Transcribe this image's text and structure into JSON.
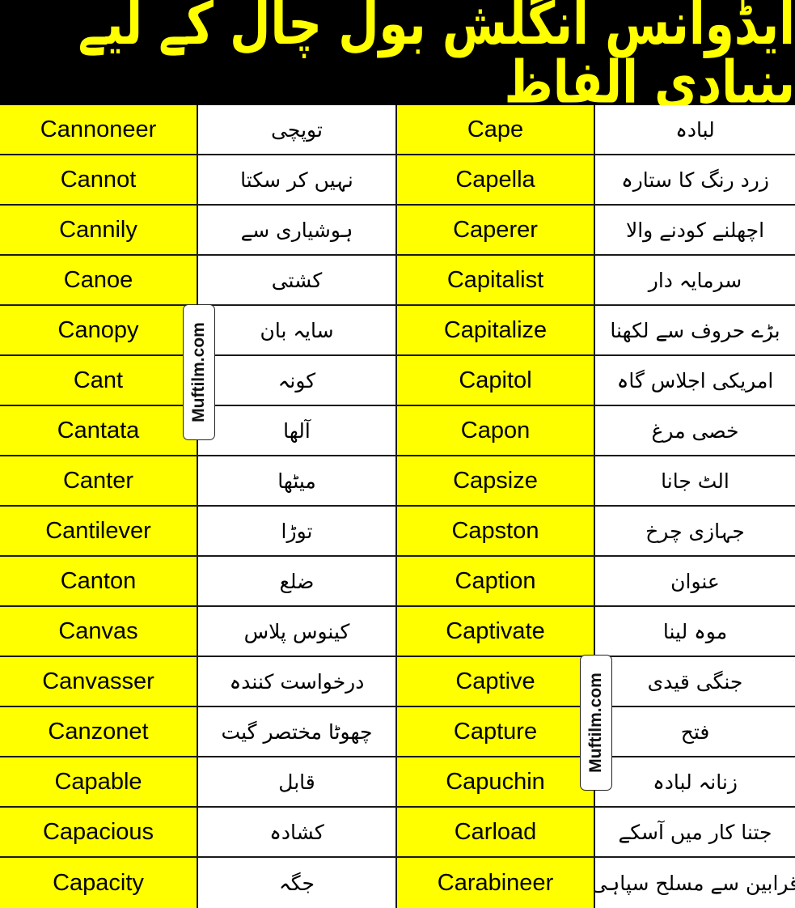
{
  "header": {
    "title": "ایڈوانس انگلش بول چال کے لیے بنیادی الفاظ"
  },
  "colors": {
    "header_bg": "#000000",
    "title_color": "#ffff00",
    "english_cell_bg": "#ffff00",
    "urdu_cell_bg": "#ffffff",
    "grid_line": "#1a1a1a"
  },
  "watermark": {
    "text": "Muftilm.com"
  },
  "rows": [
    {
      "left_en": "Cannoneer",
      "left_ur": "توپچی",
      "right_en": "Cape",
      "right_ur": "لبادہ"
    },
    {
      "left_en": "Cannot",
      "left_ur": "نہیں کر سکتا",
      "right_en": "Capella",
      "right_ur": "زرد رنگ کا ستارہ"
    },
    {
      "left_en": "Cannily",
      "left_ur": "ہوشیاری سے",
      "right_en": "Caperer",
      "right_ur": "اچھلنے کودنے والا"
    },
    {
      "left_en": "Canoe",
      "left_ur": "کشتی",
      "right_en": "Capitalist",
      "right_ur": "سرمایہ دار"
    },
    {
      "left_en": "Canopy",
      "left_ur": "سایہ بان",
      "right_en": "Capitalize",
      "right_ur": "بڑے حروف سے لکھنا"
    },
    {
      "left_en": "Cant",
      "left_ur": "کونہ",
      "right_en": "Capitol",
      "right_ur": "امریکی اجلاس گاہ"
    },
    {
      "left_en": "Cantata",
      "left_ur": "آلھا",
      "right_en": "Capon",
      "right_ur": "خصی مرغ"
    },
    {
      "left_en": "Canter",
      "left_ur": "میٹھا",
      "right_en": "Capsize",
      "right_ur": "الٹ جانا"
    },
    {
      "left_en": "Cantilever",
      "left_ur": "توڑا",
      "right_en": "Capston",
      "right_ur": "جہازی چرخ"
    },
    {
      "left_en": "Canton",
      "left_ur": "ضلع",
      "right_en": "Caption",
      "right_ur": "عنوان"
    },
    {
      "left_en": "Canvas",
      "left_ur": "کینوس پلاس",
      "right_en": "Captivate",
      "right_ur": "موہ لینا"
    },
    {
      "left_en": "Canvasser",
      "left_ur": "درخواست کنندہ",
      "right_en": "Captive",
      "right_ur": "جنگی قیدی"
    },
    {
      "left_en": "Canzonet",
      "left_ur": "چھوٹا مختصر گیت",
      "right_en": "Capture",
      "right_ur": "فتح"
    },
    {
      "left_en": "Capable",
      "left_ur": "قابل",
      "right_en": "Capuchin",
      "right_ur": "زنانہ لبادہ"
    },
    {
      "left_en": "Capacious",
      "left_ur": "کشادہ",
      "right_en": "Carload",
      "right_ur": "جتنا کار میں آسکے"
    },
    {
      "left_en": "Capacity",
      "left_ur": "جگہ",
      "right_en": "Carabineer",
      "right_ur": "قرابین سے مسلح سپاہی"
    }
  ]
}
